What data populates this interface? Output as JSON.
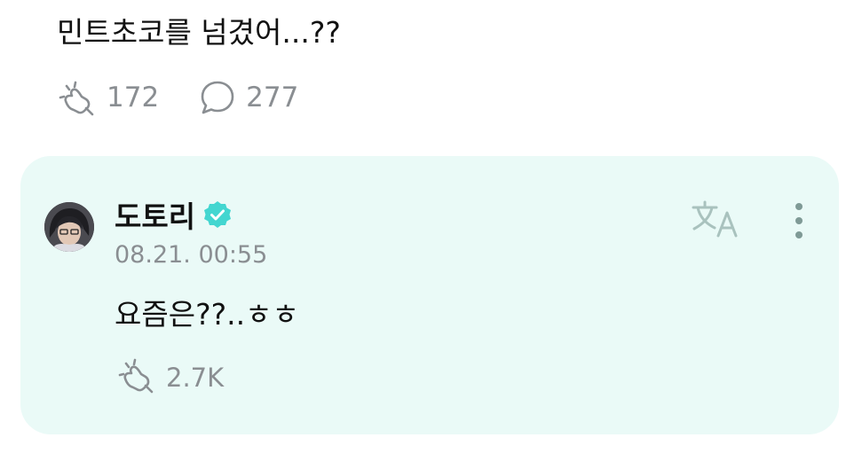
{
  "post": {
    "text": "민트초코를 넘겼어...??",
    "likes_count": "172",
    "comments_count": "277",
    "like_icon": "like-hand-icon",
    "comment_icon": "speech-bubble-icon"
  },
  "comment": {
    "author_name": "도토리",
    "verified_icon": "verified-badge-icon",
    "timestamp": "08.21. 00:55",
    "text": "요즘은??..ㅎㅎ",
    "likes_count": "2.7K",
    "translate_icon": "translate-icon",
    "more_icon": "more-vertical-icon"
  },
  "colors": {
    "card_background": "#eafaf7",
    "muted_text": "#8a8e92",
    "verified_badge": "#43d6d0",
    "translate_icon": "#a9c2be",
    "more_icon": "#7f9a96"
  }
}
